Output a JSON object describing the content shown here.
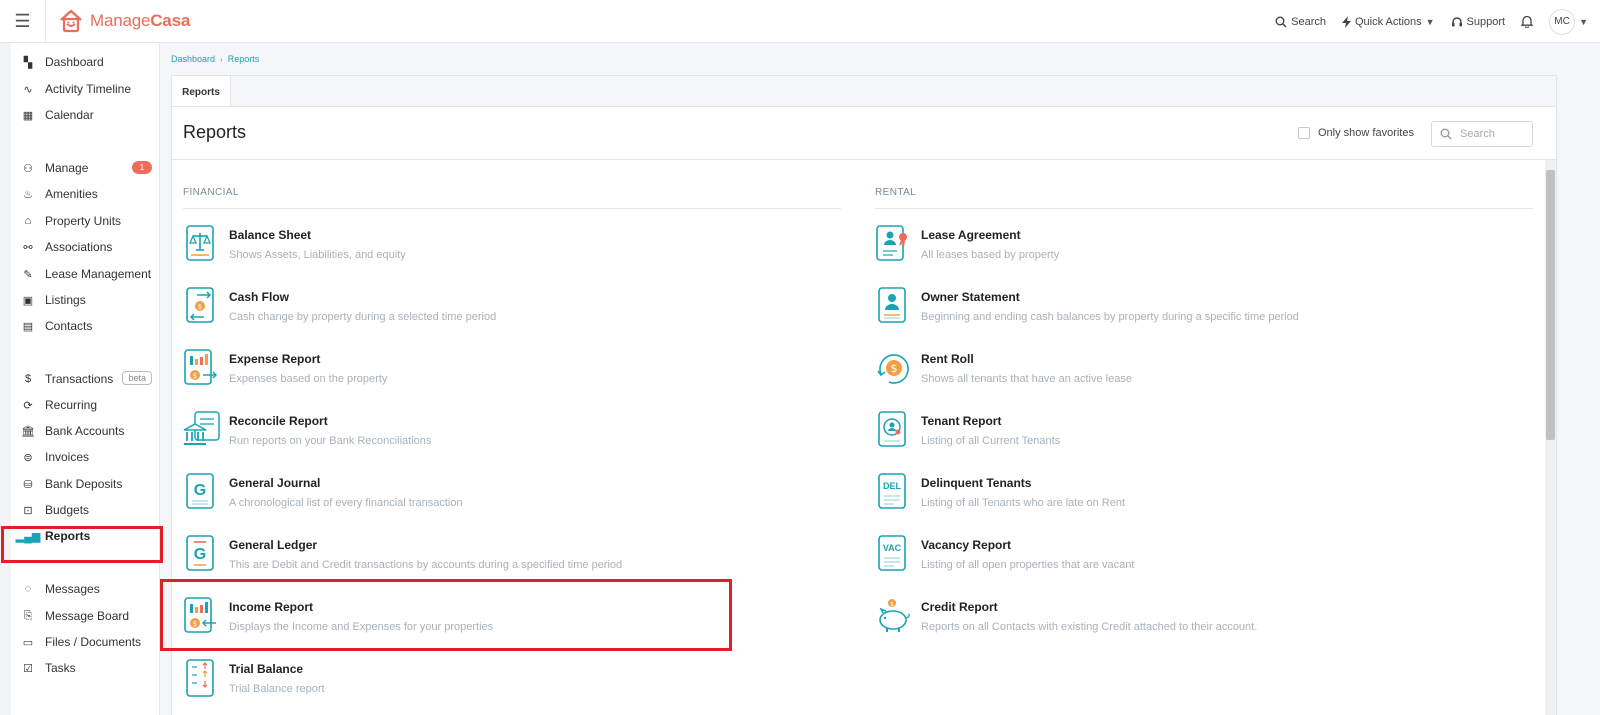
{
  "brand": {
    "name_light": "Manage",
    "name_bold": "Casa",
    "color": "#e8705a"
  },
  "topbar": {
    "search": "Search",
    "quick_actions": "Quick Actions",
    "support": "Support",
    "avatar": "MC"
  },
  "sidebar": {
    "items": [
      {
        "label": "Dashboard",
        "icon": "dashboard-icon"
      },
      {
        "label": "Activity Timeline",
        "icon": "pulse-icon"
      },
      {
        "label": "Calendar",
        "icon": "calendar-icon"
      },
      {
        "label": "Manage",
        "icon": "manage-icon",
        "badge": "1"
      },
      {
        "label": "Amenities",
        "icon": "amenities-icon"
      },
      {
        "label": "Property Units",
        "icon": "home-icon"
      },
      {
        "label": "Associations",
        "icon": "associations-icon"
      },
      {
        "label": "Lease Management",
        "icon": "edit-icon"
      },
      {
        "label": "Listings",
        "icon": "listings-icon"
      },
      {
        "label": "Contacts",
        "icon": "contacts-icon"
      },
      {
        "label": "Transactions",
        "icon": "dollar-icon",
        "tag": "beta"
      },
      {
        "label": "Recurring",
        "icon": "recurring-icon"
      },
      {
        "label": "Bank Accounts",
        "icon": "bank-icon"
      },
      {
        "label": "Invoices",
        "icon": "invoice-icon"
      },
      {
        "label": "Bank Deposits",
        "icon": "deposit-icon"
      },
      {
        "label": "Budgets",
        "icon": "budget-icon"
      },
      {
        "label": "Reports",
        "icon": "reports-icon",
        "active": true
      },
      {
        "label": "Messages",
        "icon": "message-icon"
      },
      {
        "label": "Message Board",
        "icon": "board-icon"
      },
      {
        "label": "Files / Documents",
        "icon": "folder-icon"
      },
      {
        "label": "Tasks",
        "icon": "tasks-icon"
      }
    ]
  },
  "breadcrumb": {
    "home": "Dashboard",
    "current": "Reports"
  },
  "tab": "Reports",
  "page_title": "Reports",
  "favorites_label": "Only show favorites",
  "search_placeholder": "Search",
  "financial": {
    "title": "FINANCIAL",
    "reports": [
      {
        "name": "Balance Sheet",
        "desc": "Shows Assets, Liabilities, and equity",
        "icon": "scale-icon"
      },
      {
        "name": "Cash Flow",
        "desc": "Cash change by property during a selected time period",
        "icon": "cash-flow-icon"
      },
      {
        "name": "Expense Report",
        "desc": "Expenses based on the property",
        "icon": "expense-icon"
      },
      {
        "name": "Reconcile Report",
        "desc": "Run reports on your Bank Reconciliations",
        "icon": "bank-building-icon"
      },
      {
        "name": "General Journal",
        "desc": "A chronological list of every financial transaction",
        "icon": "journal-g-icon"
      },
      {
        "name": "General Ledger",
        "desc": "This are Debit and Credit transactions by accounts during a specified time period",
        "icon": "ledger-g-icon"
      },
      {
        "name": "Income Report",
        "desc": "Displays the Income and Expenses for your properties",
        "icon": "income-icon"
      },
      {
        "name": "Trial Balance",
        "desc": "Trial Balance report",
        "icon": "trial-balance-icon"
      }
    ]
  },
  "rental": {
    "title": "RENTAL",
    "reports": [
      {
        "name": "Lease Agreement",
        "desc": "All leases based by property",
        "icon": "lease-icon"
      },
      {
        "name": "Owner Statement",
        "desc": "Beginning and ending cash balances by property during a specific time period",
        "icon": "owner-icon"
      },
      {
        "name": "Rent Roll",
        "desc": "Shows all tenants that have an active lease",
        "icon": "rent-roll-icon"
      },
      {
        "name": "Tenant Report",
        "desc": "Listing of all Current Tenants",
        "icon": "tenant-icon"
      },
      {
        "name": "Delinquent Tenants",
        "desc": "Listing of all Tenants who are late on Rent",
        "icon": "del-icon",
        "icon_text": "DEL"
      },
      {
        "name": "Vacancy Report",
        "desc": "Listing of all open properties that are vacant",
        "icon": "vac-icon",
        "icon_text": "VAC"
      },
      {
        "name": "Credit Report",
        "desc": "Reports on all Contacts with existing Credit attached to their account.",
        "icon": "piggy-bank-icon"
      }
    ]
  },
  "colors": {
    "teal": "#1aa3b3",
    "orange": "#f0a044",
    "red": "#ef6b5a",
    "highlight": "#e01f26"
  }
}
